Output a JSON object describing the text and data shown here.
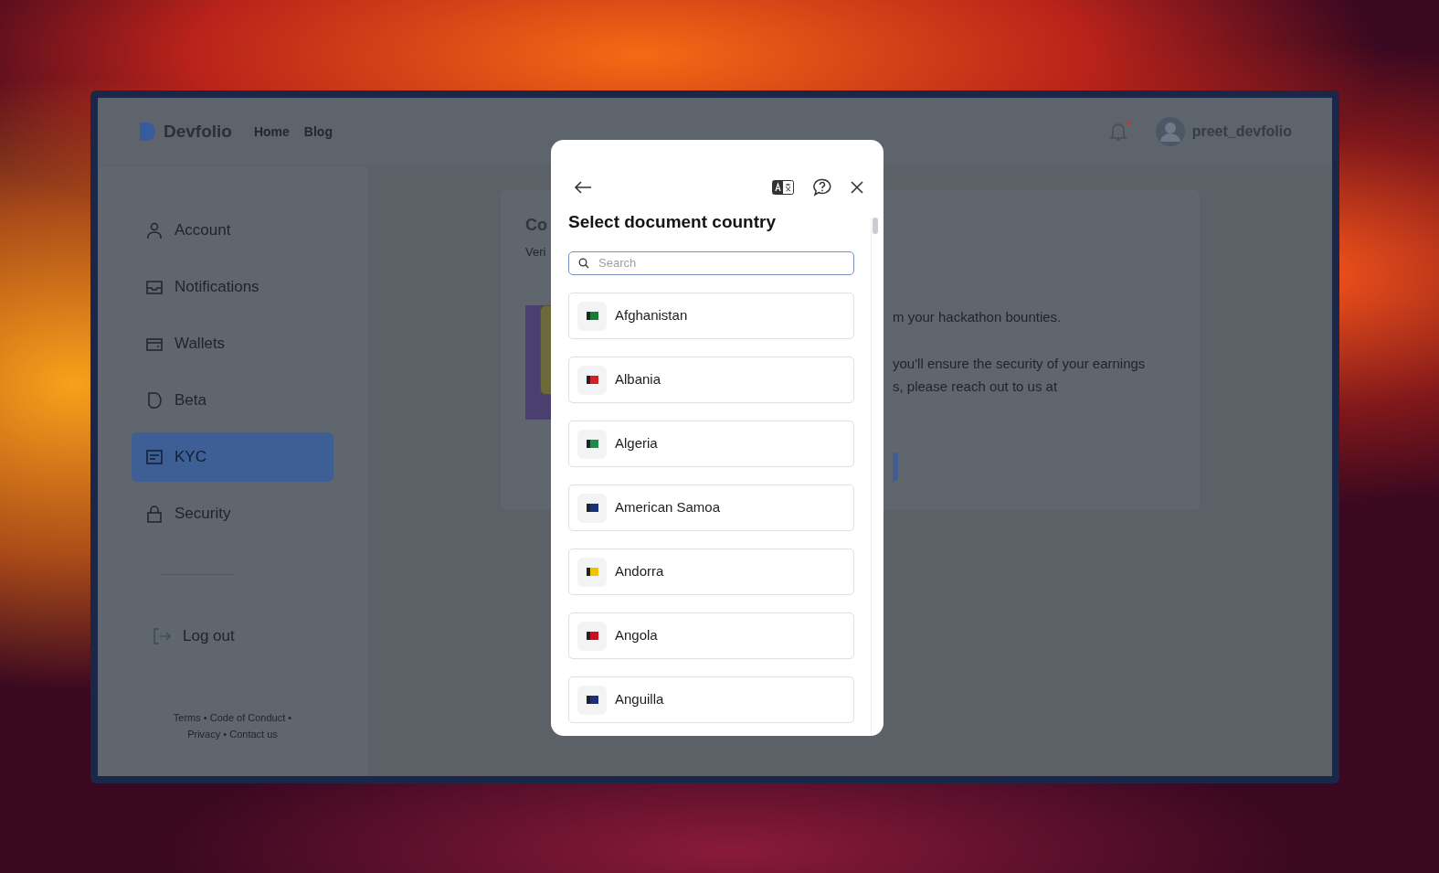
{
  "header": {
    "brand": "Devfolio",
    "nav": [
      "Home",
      "Blog"
    ],
    "notification_unread": true,
    "username": "preet_devfolio"
  },
  "sidebar": {
    "items": [
      {
        "label": "Account",
        "selected": false
      },
      {
        "label": "Notifications",
        "selected": false
      },
      {
        "label": "Wallets",
        "selected": false
      },
      {
        "label": "Beta",
        "selected": false
      },
      {
        "label": "KYC",
        "selected": true
      },
      {
        "label": "Security",
        "selected": false
      }
    ],
    "logout": "Log out",
    "footer": {
      "separator": "•",
      "links": [
        "Terms",
        "Code of Conduct",
        "Privacy",
        "Contact us"
      ]
    }
  },
  "content": {
    "title": "Co",
    "subtitle": "Veri",
    "lines": [
      "m your hackathon bounties.",
      "you'll ensure the security of your earnings",
      "s, please reach out to us at"
    ]
  },
  "modal": {
    "title": "Select document country",
    "search": {
      "placeholder": "Search"
    },
    "countries": [
      {
        "name": "Afghanistan",
        "color": "#1a7a3a"
      },
      {
        "name": "Albania",
        "color": "#d0202a"
      },
      {
        "name": "Algeria",
        "color": "#1f8a4c"
      },
      {
        "name": "American Samoa",
        "color": "#1a2f7a"
      },
      {
        "name": "Andorra",
        "color": "#f2c200"
      },
      {
        "name": "Angola",
        "color": "#cc1020"
      },
      {
        "name": "Anguilla",
        "color": "#1a2f7a"
      }
    ]
  }
}
